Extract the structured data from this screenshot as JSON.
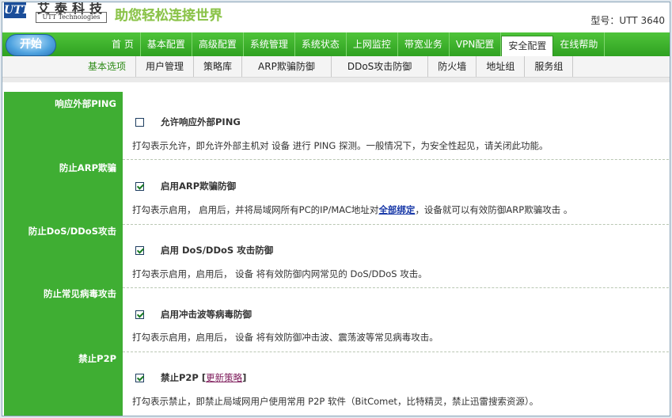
{
  "header": {
    "logo_mark": "UTT",
    "company_cn": "艾泰科技",
    "company_en": "UTT Technologies",
    "slogan": "助您轻松连接世界",
    "model": "型号：UTT 3640"
  },
  "start_label": "开始",
  "nav": [
    "首 页",
    "基本配置",
    "高级配置",
    "系统管理",
    "系统状态",
    "上网监控",
    "带宽业务",
    "VPN配置",
    "安全配置",
    "在线帮助"
  ],
  "subnav": [
    "基本选项",
    "用户管理",
    "策略库",
    "ARP欺骗防御",
    "DDoS攻击防御",
    "防火墙",
    "地址组",
    "服务组"
  ],
  "sections": [
    {
      "side": "响应外部PING",
      "label": "允许响应外部PING",
      "checked": false,
      "desc": "打勾表示允许，即允许外部主机对 设备 进行 PING 探测。一般情况下，为安全性起见，请关闭此功能。"
    },
    {
      "side": "防止ARP欺骗",
      "label": "启用ARP欺骗防御",
      "checked": true,
      "desc_pre": "打勾表示启用， 启用后，并将局域网所有PC的IP/MAC地址对",
      "desc_link": "全部绑定",
      "desc_post": "，设备就可以有效防御ARP欺骗攻击 。"
    },
    {
      "side": "防止DoS/DDoS攻击",
      "label": "启用 DoS/DDoS 攻击防御",
      "checked": true,
      "desc": "打勾表示启用，启用后， 设备 将有效防御内网常见的 DoS/DDoS 攻击。"
    },
    {
      "side": "防止常见病毒攻击",
      "label": "启用冲击波等病毒防御",
      "checked": true,
      "desc": "打勾表示启用，启用后， 设备 将有效防御冲击波、震荡波等常见病毒攻击。"
    },
    {
      "side": "禁止P2P",
      "label": "禁止P2P",
      "checked": true,
      "update_link": "更新策略",
      "desc": "打勾表示禁止，即禁止局域网用户使用常用 P2P 软件（BitComet，比特精灵，禁止迅雷搜索资源）。"
    }
  ]
}
